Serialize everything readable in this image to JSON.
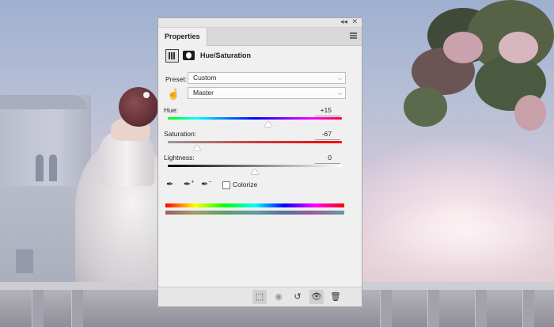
{
  "panel": {
    "tab_label": "Properties",
    "adjustment_title": "Hue/Saturation",
    "preset_label": "Preset:",
    "preset_value": "Custom",
    "channel_value": "Master",
    "hue_label": "Hue:",
    "hue_value": "+15",
    "saturation_label": "Saturation:",
    "saturation_value": "-67",
    "lightness_label": "Lightness:",
    "lightness_value": "0",
    "colorize_label": "Colorize"
  },
  "icons": {
    "collapse": "collapse-icon",
    "close": "close-icon",
    "menu": "panel-menu-icon",
    "adjustment": "hue-saturation-adjustment-icon",
    "mask": "layer-mask-icon",
    "targeted_adjust": "hand-tool-icon",
    "eyedroppers": [
      "eyedropper-icon",
      "eyedropper-plus-icon",
      "eyedropper-minus-icon"
    ],
    "bottom": [
      "clip-to-layer-icon",
      "view-previous-state-icon",
      "reset-icon",
      "visibility-icon",
      "delete-icon"
    ]
  }
}
